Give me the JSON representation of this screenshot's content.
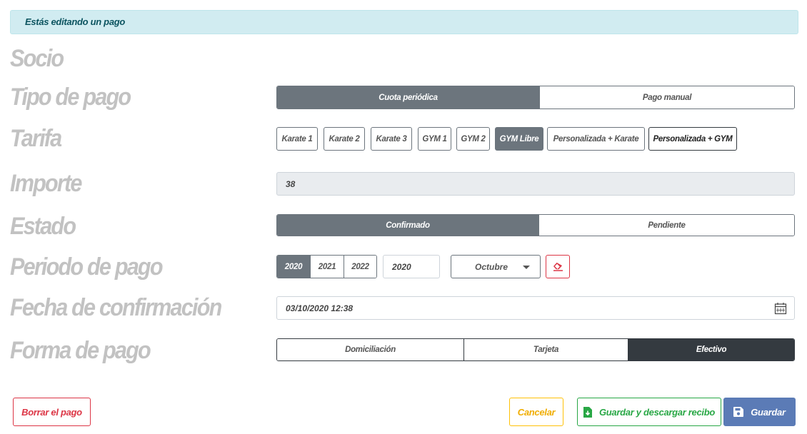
{
  "banner": "Estás editando un pago",
  "labels": {
    "socio": "Socio",
    "tipo_pago": "Tipo de pago",
    "tarifa": "Tarifa",
    "importe": "Importe",
    "estado": "Estado",
    "periodo": "Periodo de pago",
    "fecha": "Fecha de confirmación",
    "forma": "Forma de pago"
  },
  "tipo_pago": {
    "options": [
      "Cuota periódica",
      "Pago manual"
    ],
    "selected": "Cuota periódica"
  },
  "tarifa": {
    "options": [
      "Karate 1",
      "Karate 2",
      "Karate 3",
      "GYM 1",
      "GYM 2",
      "GYM Libre",
      "Personalizada + Karate",
      "Personalizada + GYM"
    ],
    "selected": "GYM Libre"
  },
  "importe": {
    "value": "38"
  },
  "estado": {
    "options": [
      "Confirmado",
      "Pendiente"
    ],
    "selected": "Confirmado"
  },
  "periodo": {
    "years": [
      "2020",
      "2021",
      "2022"
    ],
    "selected_year": "2020",
    "year_input": "2020",
    "month": "Octubre"
  },
  "fecha": {
    "value": "03/10/2020 12:38"
  },
  "forma_pago": {
    "options": [
      "Domiciliación",
      "Tarjeta",
      "Efectivo"
    ],
    "selected": "Efectivo"
  },
  "buttons": {
    "delete": "Borrar el pago",
    "cancel": "Cancelar",
    "save_download": "Guardar y descargar recibo",
    "save": "Guardar"
  },
  "colors": {
    "banner_bg": "#d1ecf1",
    "label": "#c2c2c2",
    "active_segment": "#6c757d",
    "active_dark": "#343a40",
    "danger": "#dc3545",
    "warning": "#ffc107",
    "success": "#28a745",
    "primary": "#5b7bb6"
  },
  "icons": [
    "eraser-icon",
    "calendar-icon",
    "file-download-icon",
    "save-icon",
    "chevron-down-icon"
  ]
}
